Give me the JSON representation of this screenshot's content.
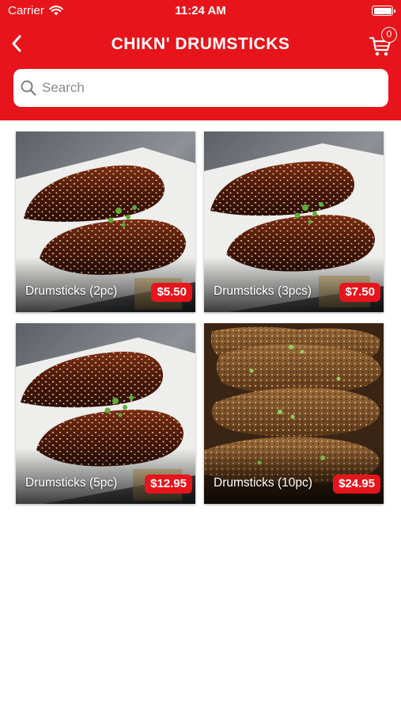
{
  "status_bar": {
    "carrier": "Carrier",
    "time": "11:24 AM"
  },
  "nav": {
    "title": "CHIKN' DRUMSTICKS",
    "cart_count": "0"
  },
  "search": {
    "placeholder": "Search",
    "value": ""
  },
  "colors": {
    "brand_red": "#e8141b",
    "background": "#ffffff"
  },
  "icons": {
    "back": "chevron-left-icon",
    "cart": "cart-icon",
    "search": "search-icon",
    "wifi": "wifi-icon",
    "battery": "battery-icon"
  },
  "products": [
    {
      "name": "Drumsticks (2pc)",
      "price": "$5.50"
    },
    {
      "name": "Drumsticks (3pcs)",
      "price": "$7.50"
    },
    {
      "name": "Drumsticks (5pc)",
      "price": "$12.95"
    },
    {
      "name": "Drumsticks (10pc)",
      "price": "$24.95"
    }
  ]
}
